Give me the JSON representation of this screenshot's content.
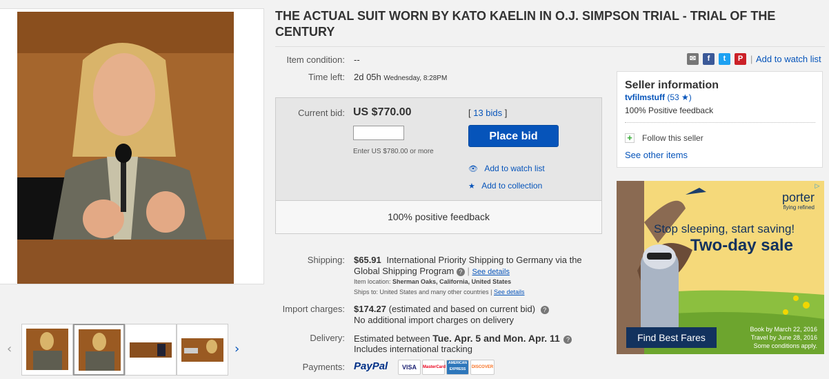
{
  "title": "THE ACTUAL SUIT WORN BY KATO KAELIN IN O.J. SIMPSON TRIAL - TRIAL OF THE CENTURY",
  "condition": {
    "label": "Item condition:",
    "value": "--"
  },
  "time_left": {
    "label": "Time left:",
    "value": "2d 05h",
    "end": "Wednesday, 8:28PM"
  },
  "share": {
    "watch_link": "Add to watch list",
    "icons": [
      "email-icon",
      "facebook-icon",
      "twitter-icon",
      "pinterest-icon"
    ]
  },
  "bid": {
    "label": "Current bid:",
    "price": "US $770.00",
    "bids": "13 bids",
    "bids_open": "[ ",
    "bids_close": " ]",
    "input_value": "",
    "hint": "Enter US $780.00 or more",
    "button": "Place bid",
    "watch": "Add to watch list",
    "collection": "Add to collection",
    "feedback": "100% positive feedback"
  },
  "seller": {
    "heading": "Seller information",
    "name": "tvfilmstuff",
    "score": "(53",
    "score_close": ")",
    "feedback": "100% Positive feedback",
    "follow": "Follow this seller",
    "other": "See other items"
  },
  "shipping": {
    "label": "Shipping:",
    "cost": "$65.91",
    "desc1": "International Priority Shipping to Germany  via the",
    "desc2": "Global Shipping Program",
    "details": "See details",
    "location_label": "Item location:",
    "location": "Sherman Oaks, California, United States",
    "ships_label": "Ships to:",
    "ships": "United States and many other countries |",
    "ships_details": "See details"
  },
  "import": {
    "label": "Import charges:",
    "cost": "$174.27",
    "desc": "(estimated and based on current bid)",
    "note": "No additional import charges on delivery"
  },
  "delivery": {
    "label": "Delivery:",
    "prefix": "Estimated between",
    "dates": "Tue. Apr. 5 and Mon. Apr. 11",
    "note": "Includes international tracking"
  },
  "payments": {
    "label": "Payments:",
    "paypal": "PayPal",
    "cards": [
      "VISA",
      "MasterCard",
      "AMERICAN EXPRESS",
      "DISCOVER"
    ]
  },
  "ad": {
    "brand": "porter",
    "tagline": "flying refined",
    "headline": "Stop sleeping, start saving!",
    "sale": "Two-day sale",
    "cta": "Find Best Fares",
    "fine1": "Book by March 22, 2016",
    "fine2": "Travel by June 28, 2016",
    "fine3": "Some conditions apply."
  },
  "colors": {
    "link": "#0654ba",
    "button": "#0654ba",
    "ad_bg": "#f5d97a",
    "ad_navy": "#12325e"
  }
}
